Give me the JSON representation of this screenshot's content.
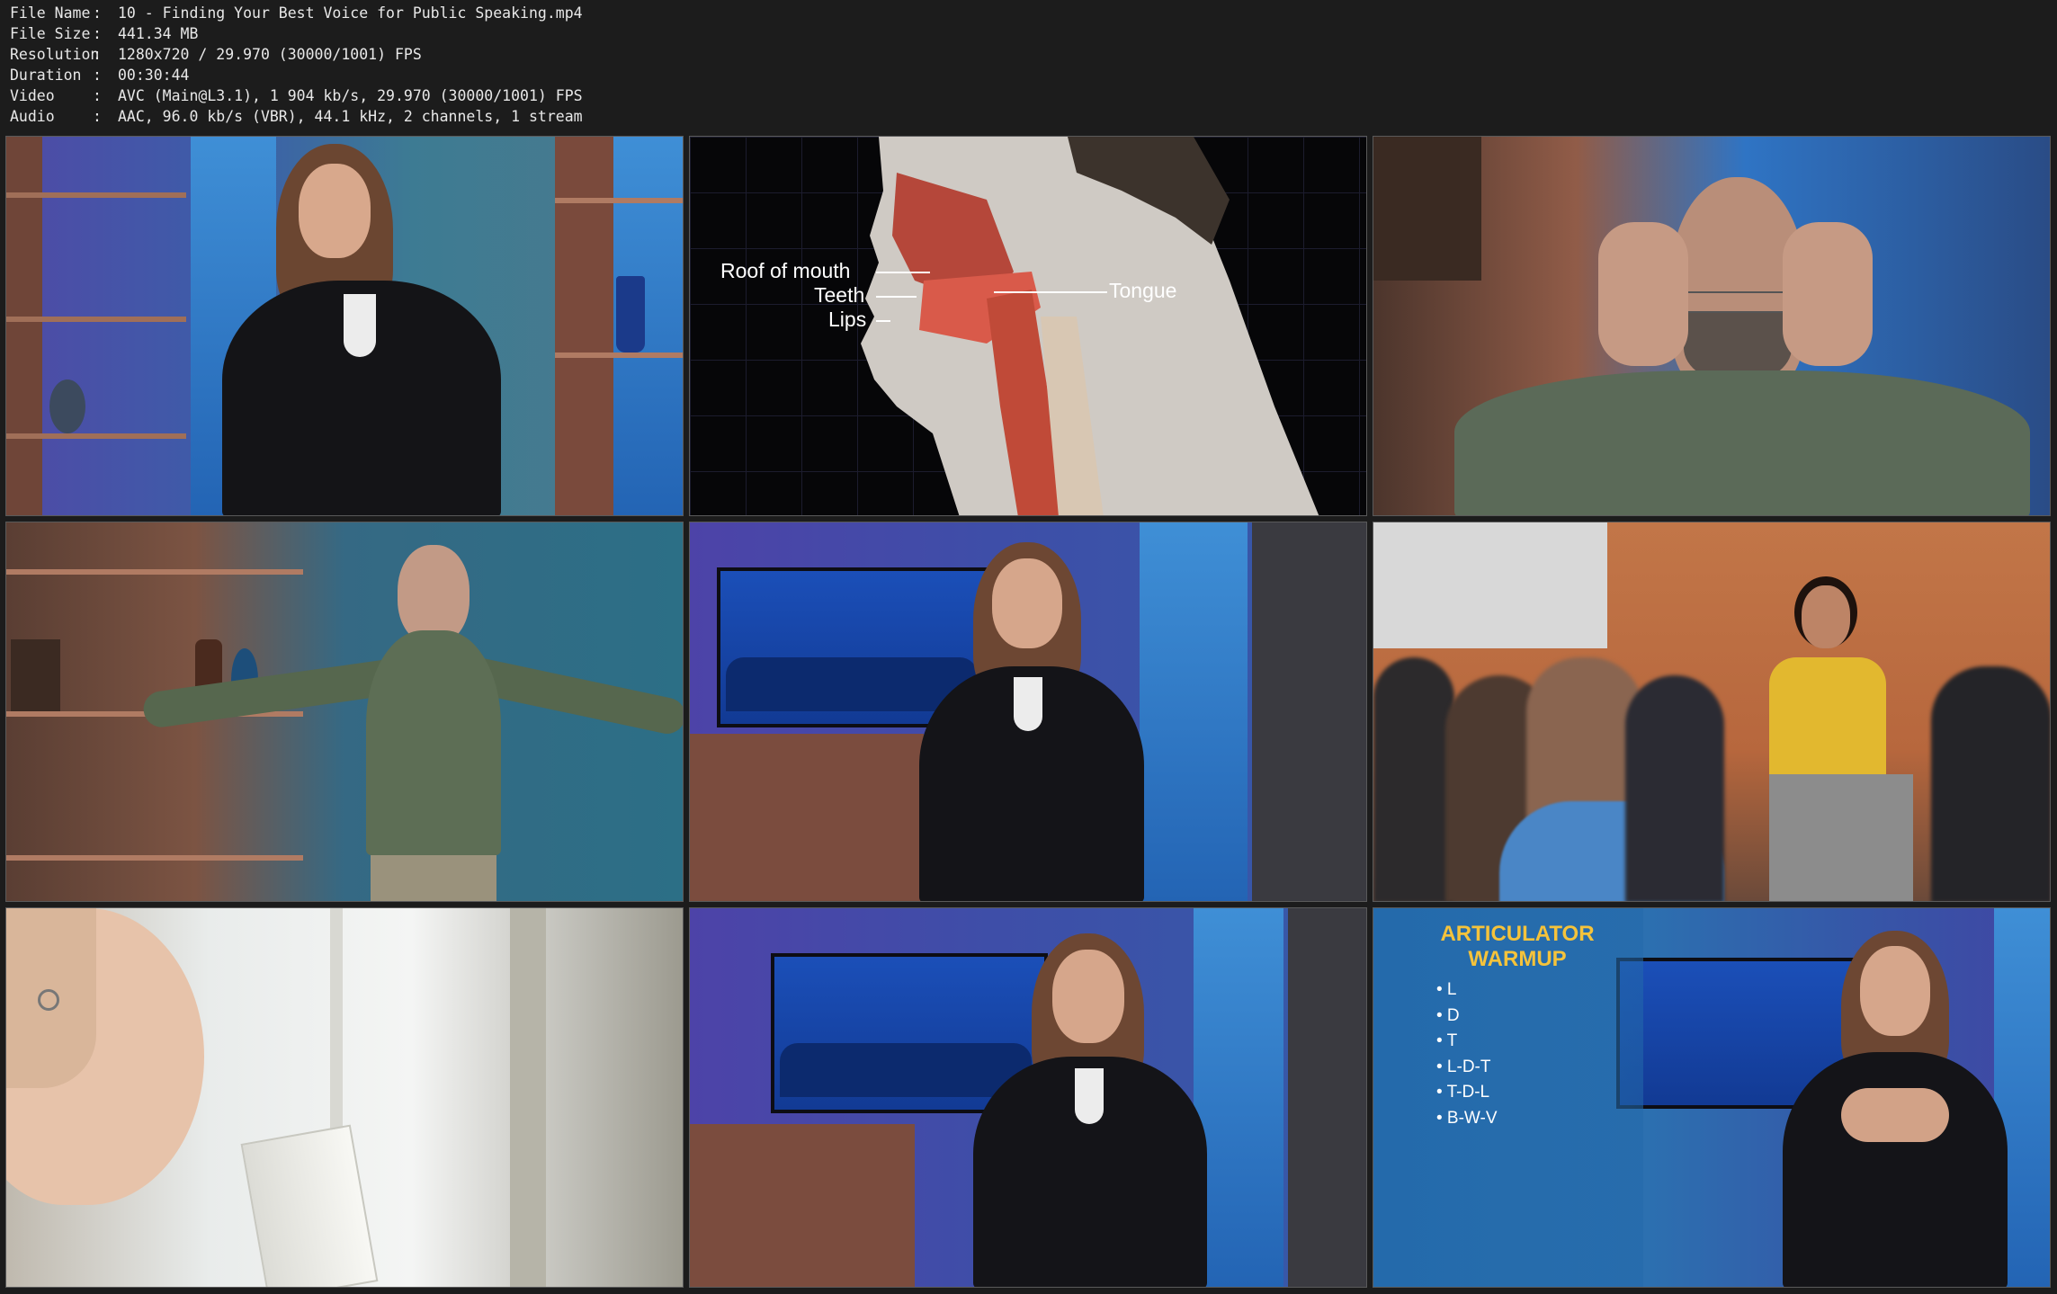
{
  "meta": {
    "rows": [
      {
        "label": "File Name",
        "sep": ":",
        "value": "10 - Finding Your Best Voice for Public Speaking.mp4"
      },
      {
        "label": "File Size",
        "sep": ":",
        "value": "441.34 MB"
      },
      {
        "label": "Resolution",
        "sep": ":",
        "value": "1280x720 / 29.970 (30000/1001) FPS"
      },
      {
        "label": "Duration",
        "sep": ":",
        "value": "00:30:44"
      },
      {
        "label": "Video",
        "sep": ":",
        "value": "AVC (Main@L3.1), 1 904 kb/s, 29.970 (30000/1001) FPS"
      },
      {
        "label": "Audio",
        "sep": ":",
        "value": "AAC, 96.0 kb/s (VBR), 44.1 kHz, 2 channels, 1 stream"
      }
    ]
  },
  "frames": {
    "anatomy": {
      "roof": "Roof of mouth",
      "teeth": "Teeth",
      "lips": "Lips",
      "tongue": "Tongue"
    },
    "warmup": {
      "title_line1": "ARTICULATOR",
      "title_line2": "WARMUP",
      "items": [
        "• L",
        "• D",
        "• T",
        "• L-D-T",
        "• T-D-L",
        "• B-W-V"
      ]
    }
  },
  "colors": {
    "set_blue": "#2f76c9",
    "shelf_wood": "#8a5a48",
    "warmup_title": "#f5c33b"
  }
}
